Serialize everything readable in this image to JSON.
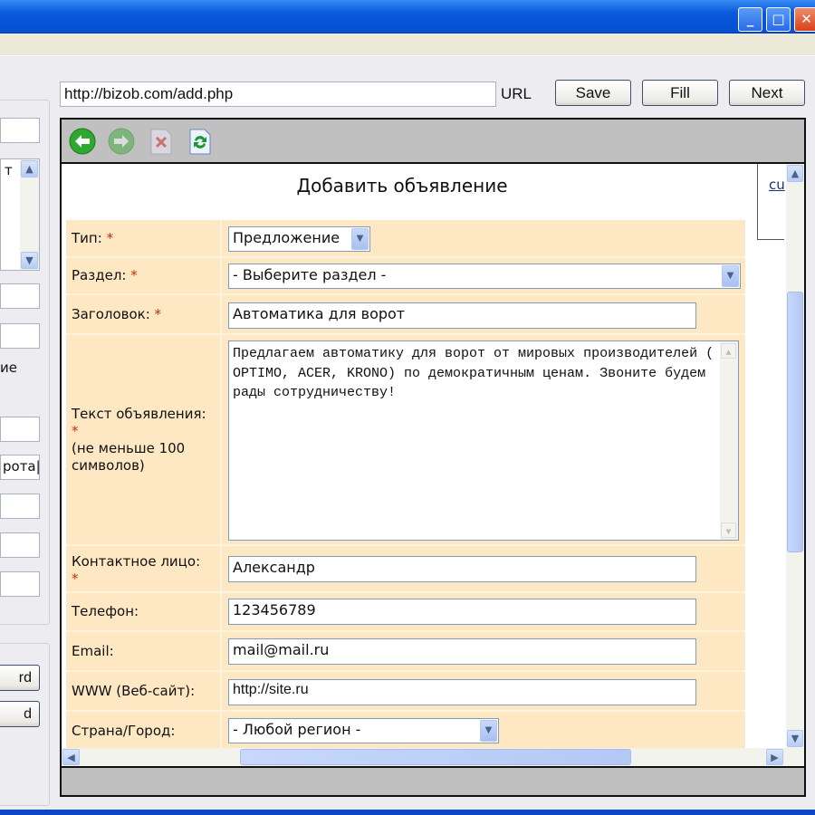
{
  "window": {
    "minimize_icon": "minimize-icon",
    "maximize_icon": "maximize-icon",
    "close_icon": "close-icon"
  },
  "left_panel": {
    "text_fragment_1": "т",
    "text_fragment_2": "ие",
    "input_value": "рота",
    "button_1": "rd",
    "button_2": "d"
  },
  "toolbar": {
    "url": "http://bizob.com/add.php",
    "url_label": "URL",
    "save_label": "Save",
    "fill_label": "Fill",
    "next_label": "Next"
  },
  "browser": {
    "nav_icons": [
      "back-icon",
      "forward-icon",
      "stop-icon",
      "refresh-icon"
    ],
    "side_link": "cu"
  },
  "form": {
    "title": "Добавить объявление",
    "required_mark": "*",
    "type_label": "Тип:",
    "type_value": "Предложение",
    "section_label": "Раздел:",
    "section_value": "- Выберите раздел -",
    "heading_label": "Заголовок:",
    "heading_value": "Автоматика для ворот",
    "text_label": "Текст объявления:",
    "text_hint": "(не меньше 100 символов)",
    "text_value": "Предлагаем автоматику для ворот от мировых производителей ( OPTIMO, ACER, KRONO) по демократичным ценам. Звоните будем рады сотрудничеству!",
    "contact_label": "Контактное лицо:",
    "contact_value": "Александр",
    "phone_label": "Телефон:",
    "phone_value": "123456789",
    "email_label": "Email:",
    "email_value": "mail@mail.ru",
    "www_label": "WWW (Веб-сайт):",
    "www_value": "http://site.ru",
    "region_label": "Страна/Город:",
    "region_value": "- Любой регион -"
  },
  "colors": {
    "form_bg": "#fde8c3",
    "required": "#c03010",
    "titlebar": "#0a58dc"
  }
}
